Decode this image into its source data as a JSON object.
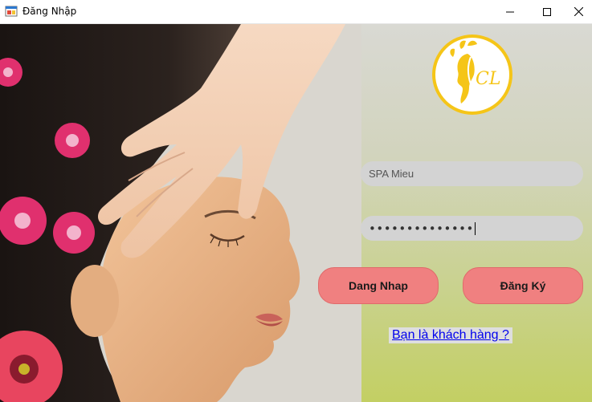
{
  "window": {
    "title": "Đăng Nhập",
    "controls": [
      "minimize-icon",
      "maximize-icon",
      "close-icon"
    ]
  },
  "logo": {
    "monogram": "CL"
  },
  "form": {
    "username_value": "SPA Mieu",
    "password_masked": "••••••••••••••"
  },
  "buttons": {
    "login_label": "Dang Nhap",
    "register_label": "Đăng Ký"
  },
  "customer_link": "Bạn là khách hàng ?",
  "colors": {
    "button_bg": "#f08080",
    "field_bg": "#d3d3d3",
    "logo_ring": "#f5c518",
    "link": "#0000ee"
  }
}
